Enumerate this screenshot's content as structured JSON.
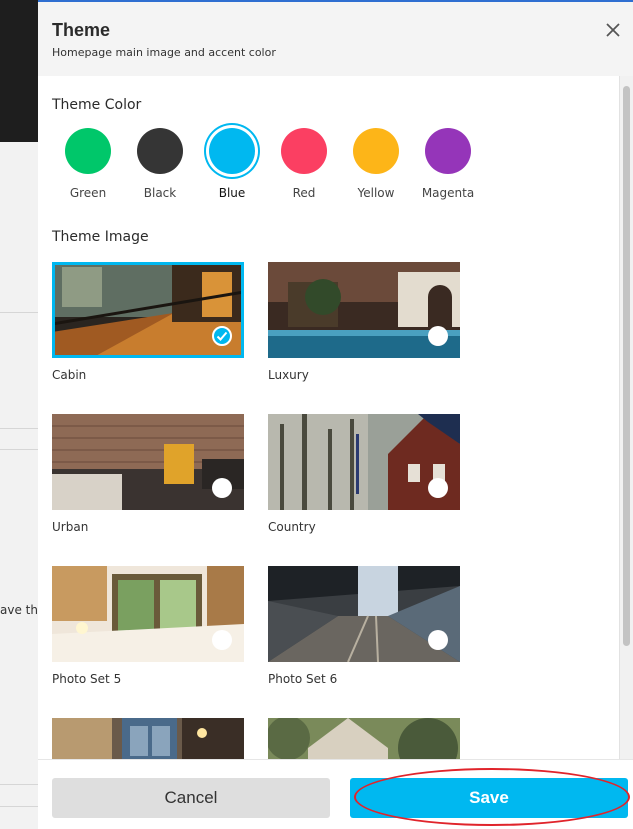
{
  "background": {
    "fragment_text": "ave th"
  },
  "modal": {
    "title": "Theme",
    "subtitle": "Homepage main image and accent color",
    "close_icon": "close-icon"
  },
  "theme_color": {
    "heading": "Theme Color",
    "options": [
      {
        "label": "Green",
        "color": "#00c76a",
        "selected": false
      },
      {
        "label": "Black",
        "color": "#353535",
        "selected": false
      },
      {
        "label": "Blue",
        "color": "#00b8f0",
        "selected": true
      },
      {
        "label": "Red",
        "color": "#fb3f62",
        "selected": false
      },
      {
        "label": "Yellow",
        "color": "#fdb518",
        "selected": false
      },
      {
        "label": "Magenta",
        "color": "#9535b9",
        "selected": false
      }
    ]
  },
  "theme_image": {
    "heading": "Theme Image",
    "items": [
      {
        "label": "Cabin",
        "selected": true
      },
      {
        "label": "Luxury",
        "selected": false
      },
      {
        "label": "Urban",
        "selected": false
      },
      {
        "label": "Country",
        "selected": false
      },
      {
        "label": "Photo Set 5",
        "selected": false
      },
      {
        "label": "Photo Set 6",
        "selected": false
      },
      {
        "label": "",
        "selected": false
      },
      {
        "label": "",
        "selected": false
      }
    ]
  },
  "footer": {
    "cancel_label": "Cancel",
    "save_label": "Save"
  },
  "accent_color": "#00b8f0",
  "highlight_color": "#e0242b"
}
